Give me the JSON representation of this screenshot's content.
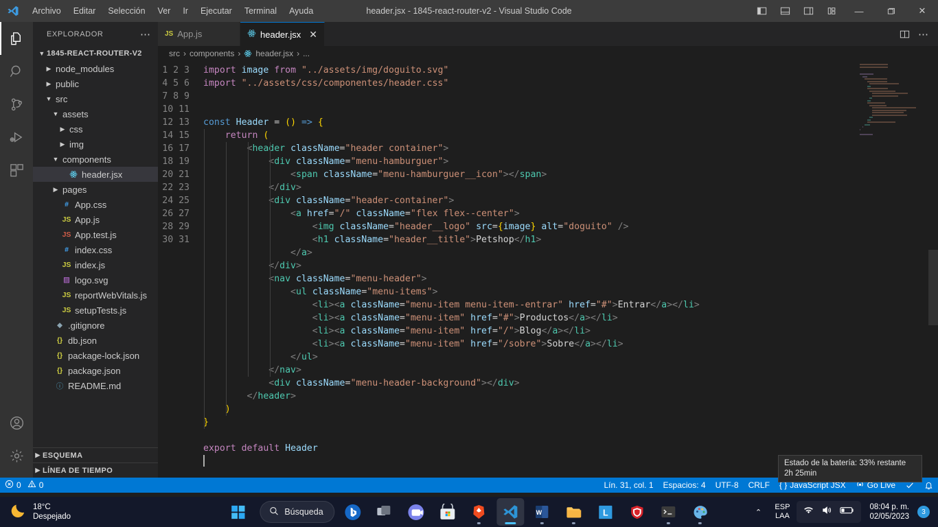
{
  "titlebar": {
    "logo_icon": "vscode-logo-icon",
    "menus": [
      "Archivo",
      "Editar",
      "Selección",
      "Ver",
      "Ir",
      "Ejecutar",
      "Terminal",
      "Ayuda"
    ],
    "window_title": "header.jsx - 1845-react-router-v2 - Visual Studio Code",
    "layout_buttons": [
      "toggle-primary-sidebar-icon",
      "toggle-panel-icon",
      "toggle-secondary-sidebar-icon",
      "customize-layout-icon"
    ],
    "window_controls": {
      "minimize": "—",
      "maximize": "▢",
      "close": "✕"
    }
  },
  "activitybar": {
    "items": [
      {
        "name": "explorer-icon",
        "active": true
      },
      {
        "name": "search-icon",
        "active": false
      },
      {
        "name": "source-control-icon",
        "active": false
      },
      {
        "name": "run-and-debug-icon",
        "active": false
      },
      {
        "name": "extensions-icon",
        "active": false
      }
    ],
    "bottom": [
      {
        "name": "accounts-icon"
      },
      {
        "name": "manage-settings-gear-icon"
      }
    ]
  },
  "sidebar": {
    "header_title": "EXPLORADOR",
    "more_actions": "⋯",
    "root_folder": "1845-REACT-ROUTER-V2",
    "tree": [
      {
        "label": "node_modules",
        "type": "folder",
        "depth": 1,
        "expanded": false
      },
      {
        "label": "public",
        "type": "folder",
        "depth": 1,
        "expanded": false
      },
      {
        "label": "src",
        "type": "folder",
        "depth": 1,
        "expanded": true
      },
      {
        "label": "assets",
        "type": "folder",
        "depth": 2,
        "expanded": true
      },
      {
        "label": "css",
        "type": "folder",
        "depth": 3,
        "expanded": false
      },
      {
        "label": "img",
        "type": "folder",
        "depth": 3,
        "expanded": false
      },
      {
        "label": "components",
        "type": "folder",
        "depth": 2,
        "expanded": true
      },
      {
        "label": "header.jsx",
        "type": "react",
        "depth": 3,
        "selected": true
      },
      {
        "label": "pages",
        "type": "folder",
        "depth": 2,
        "expanded": false
      },
      {
        "label": "App.css",
        "type": "css",
        "depth": 2
      },
      {
        "label": "App.js",
        "type": "js",
        "depth": 2
      },
      {
        "label": "App.test.js",
        "type": "test",
        "depth": 2
      },
      {
        "label": "index.css",
        "type": "css",
        "depth": 2
      },
      {
        "label": "index.js",
        "type": "js",
        "depth": 2
      },
      {
        "label": "logo.svg",
        "type": "svg",
        "depth": 2
      },
      {
        "label": "reportWebVitals.js",
        "type": "js",
        "depth": 2
      },
      {
        "label": "setupTests.js",
        "type": "js",
        "depth": 2
      },
      {
        "label": ".gitignore",
        "type": "git",
        "depth": 1
      },
      {
        "label": "db.json",
        "type": "json",
        "depth": 1
      },
      {
        "label": "package-lock.json",
        "type": "json",
        "depth": 1
      },
      {
        "label": "package.json",
        "type": "json",
        "depth": 1
      },
      {
        "label": "README.md",
        "type": "md",
        "depth": 1
      }
    ],
    "panels": [
      {
        "label": "ESQUEMA"
      },
      {
        "label": "LÍNEA DE TIEMPO"
      }
    ]
  },
  "editor": {
    "tabs": [
      {
        "label": "App.js",
        "icon": "js-file-icon",
        "active": false
      },
      {
        "label": "header.jsx",
        "icon": "react-file-icon",
        "active": true,
        "close": "✕"
      }
    ],
    "tab_actions": [
      "split-editor-icon",
      "more-actions-icon"
    ],
    "breadcrumb": [
      "src",
      "components",
      "header.jsx",
      "..."
    ],
    "breadcrumb_separator": "›",
    "total_lines": 31,
    "code_lines": [
      "import image from \"../assets/img/doguito.svg\"",
      "import \"../assets/css/componentes/header.css\"",
      "",
      "",
      "const Header = () => {",
      "    return (",
      "        <header className=\"header container\">",
      "            <div className=\"menu-hamburguer\">",
      "                <span className=\"menu-hamburguer__icon\"></span>",
      "            </div>",
      "            <div className=\"header-container\">",
      "                <a href=\"/\" className=\"flex flex--center\">",
      "                    <img className=\"header__logo\" src={image} alt=\"doguito\" />",
      "                    <h1 className=\"header__title\">Petshop</h1>",
      "                </a>",
      "            </div>",
      "            <nav className=\"menu-header\">",
      "                <ul className=\"menu-items\">",
      "                    <li><a className=\"menu-item menu-item--entrar\" href=\"#\">Entrar</a></li>",
      "                    <li><a className=\"menu-item\" href=\"#\">Productos</a></li>",
      "                    <li><a className=\"menu-item\" href=\"/\">Blog</a></li>",
      "                    <li><a className=\"menu-item\" href=\"/sobre\">Sobre</a></li>",
      "                </ul>",
      "            </nav>",
      "            <div className=\"menu-header-background\"></div>",
      "        </header>",
      "    )",
      "}",
      "",
      "export default Header",
      ""
    ]
  },
  "statusbar": {
    "errors_icon": "error-circle-icon",
    "errors": "0",
    "warnings_icon": "warning-triangle-icon",
    "warnings": "0",
    "cursor_position": "Lín. 31, col. 1",
    "indentation": "Espacios: 4",
    "encoding": "UTF-8",
    "eol": "CRLF",
    "language_icon": "braces-icon",
    "language": "JavaScript JSX",
    "go_live_icon": "broadcast-icon",
    "go_live": "Go Live",
    "prettier_icon": "prettier-checkmark-icon",
    "bell_icon": "notifications-bell-icon"
  },
  "tooltip": {
    "line1": "Estado de la batería: 33% restante",
    "line2": "2h 25min"
  },
  "taskbar": {
    "weather": {
      "icon": "moon-icon",
      "temperature": "18°C",
      "condition": "Despejado"
    },
    "start_icon": "windows-start-icon",
    "search": {
      "icon": "search-icon",
      "label": "Búsqueda"
    },
    "apps": [
      {
        "name": "bing-chat-icon",
        "state": "none"
      },
      {
        "name": "task-view-icon",
        "state": "none"
      },
      {
        "name": "teams-icon",
        "state": "none"
      },
      {
        "name": "microsoft-store-icon",
        "state": "none"
      },
      {
        "name": "brave-browser-icon",
        "state": "running"
      },
      {
        "name": "vscode-icon",
        "state": "active"
      },
      {
        "name": "word-icon",
        "state": "running"
      },
      {
        "name": "file-explorer-icon",
        "state": "running"
      },
      {
        "name": "lightshot-icon",
        "state": "none"
      },
      {
        "name": "malwarebytes-icon",
        "state": "none"
      },
      {
        "name": "terminal-icon",
        "state": "running"
      },
      {
        "name": "paint-icon",
        "state": "running"
      }
    ],
    "tray": {
      "chevron": "⌃",
      "language_line1": "ESP",
      "language_line2": "LAA",
      "wifi_icon": "wifi-icon",
      "volume_icon": "speaker-icon",
      "battery_icon": "battery-low-icon",
      "time": "08:04 p. m.",
      "date": "02/05/2023",
      "notification_count": "3"
    }
  },
  "colors": {
    "accent": "#0078d4",
    "titlebar_bg": "#3c3c3c",
    "sidebar_bg": "#252526",
    "editor_bg": "#1e1e1e",
    "activitybar_bg": "#333333",
    "taskbar_bg": "#13182a"
  }
}
